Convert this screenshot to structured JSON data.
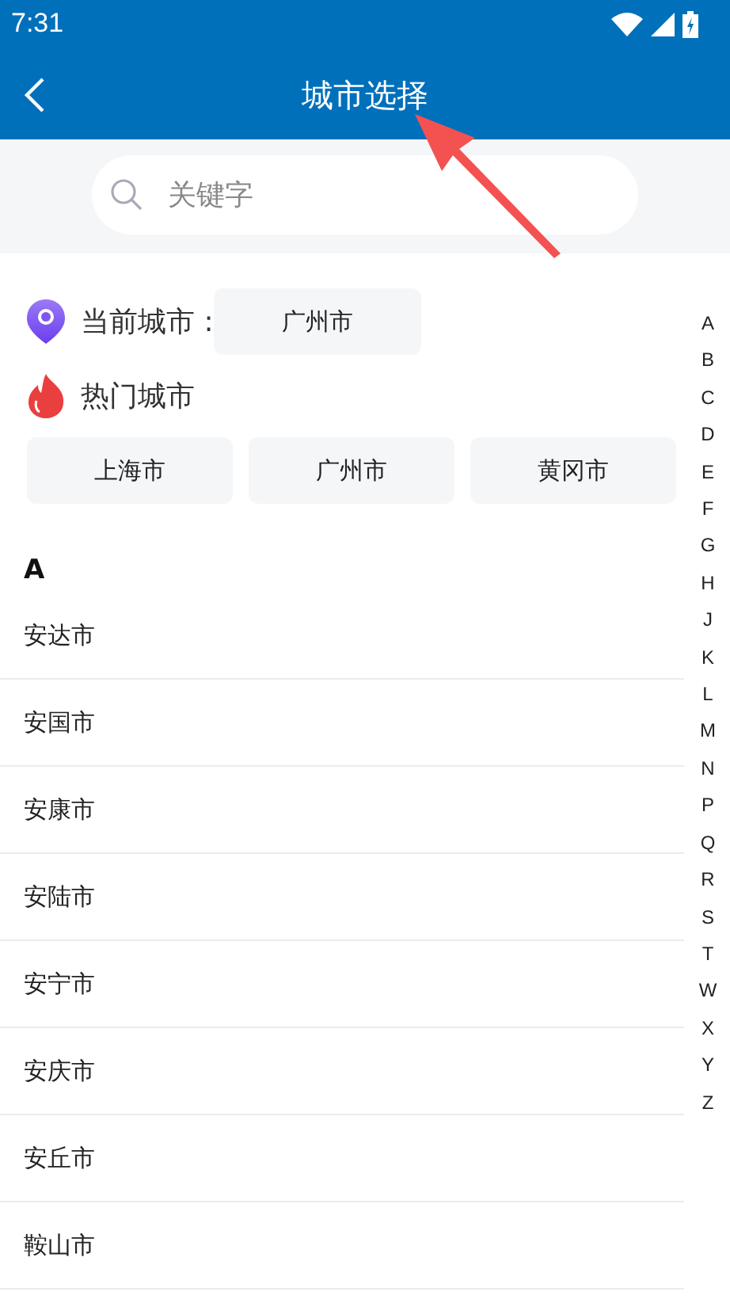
{
  "status_bar": {
    "time": "7:31"
  },
  "header": {
    "title": "城市选择"
  },
  "search": {
    "placeholder": "关键字"
  },
  "current_city": {
    "label": "当前城市 :",
    "city": "广州市"
  },
  "hot_cities": {
    "label": "热门城市",
    "cities": [
      "上海市",
      "广州市",
      "黄冈市"
    ]
  },
  "sections": [
    {
      "letter": "A",
      "cities": [
        "安达市",
        "安国市",
        "安康市",
        "安陆市",
        "安宁市",
        "安庆市",
        "安丘市",
        "鞍山市"
      ]
    }
  ],
  "index_letters": [
    "A",
    "B",
    "C",
    "D",
    "E",
    "F",
    "G",
    "H",
    "J",
    "K",
    "L",
    "M",
    "N",
    "P",
    "Q",
    "R",
    "S",
    "T",
    "W",
    "X",
    "Y",
    "Z"
  ]
}
